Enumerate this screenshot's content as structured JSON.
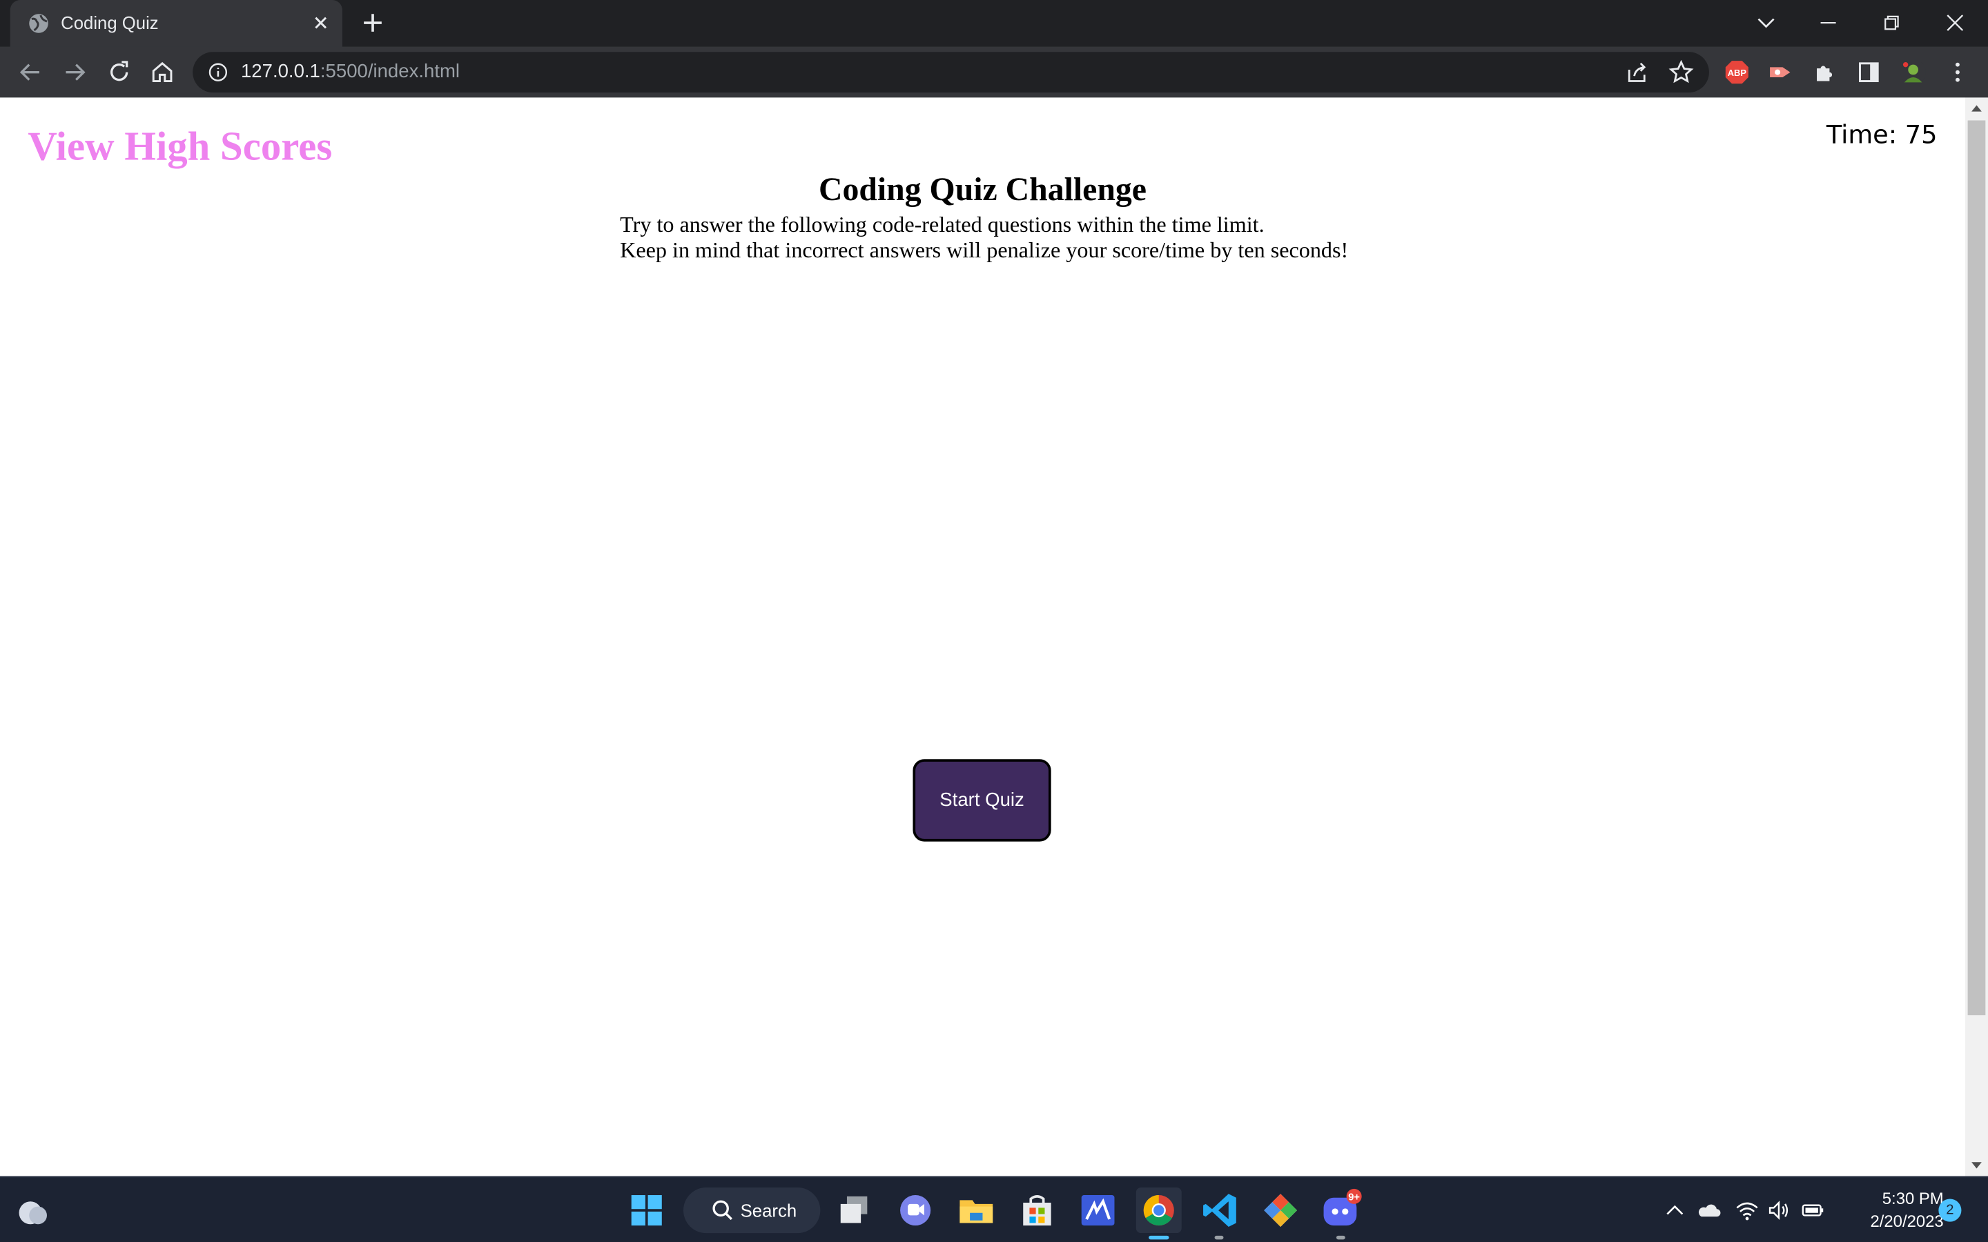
{
  "browser": {
    "tab_title": "Coding Quiz",
    "url_host": "127.0.0.1",
    "url_path": ":5500/index.html",
    "icons": [
      "globe-icon",
      "close-icon",
      "plus-icon",
      "chevron-down-icon",
      "minimize-icon",
      "restore-icon",
      "close-window-icon",
      "back-icon",
      "forward-icon",
      "reload-icon",
      "home-icon",
      "info-icon",
      "share-icon",
      "star-icon",
      "adblock-icon",
      "record-icon",
      "puzzle-icon",
      "side-panel-icon",
      "profile-icon",
      "kebab-menu-icon"
    ],
    "ext_adblock_label": "ABP"
  },
  "page": {
    "high_scores_link": "View High Scores",
    "timer": "Time: 75",
    "title": "Coding Quiz Challenge",
    "intro_line_1": "Try to answer the following code-related questions within the time limit.",
    "intro_line_2": "Keep in mind that incorrect answers will penalize your score/time by ten seconds!",
    "start_button": "Start Quiz",
    "colors": {
      "link": "#ee82ee",
      "button_bg": "#3f2a5f",
      "button_text": "#ffffff"
    }
  },
  "taskbar": {
    "search_label": "Search",
    "time": "5:30 PM",
    "date": "2/20/2023",
    "notification_count": "2",
    "discord_badge": "9+",
    "apps": [
      "windows-start-icon",
      "search-icon",
      "task-view-icon",
      "teams-chat-icon",
      "file-explorer-icon",
      "microsoft-store-icon",
      "mathworks-icon",
      "chrome-icon",
      "vscode-icon",
      "git-icon",
      "discord-icon"
    ],
    "tray": [
      "chevron-up-icon",
      "onedrive-icon",
      "wifi-icon",
      "volume-icon",
      "battery-icon"
    ]
  }
}
